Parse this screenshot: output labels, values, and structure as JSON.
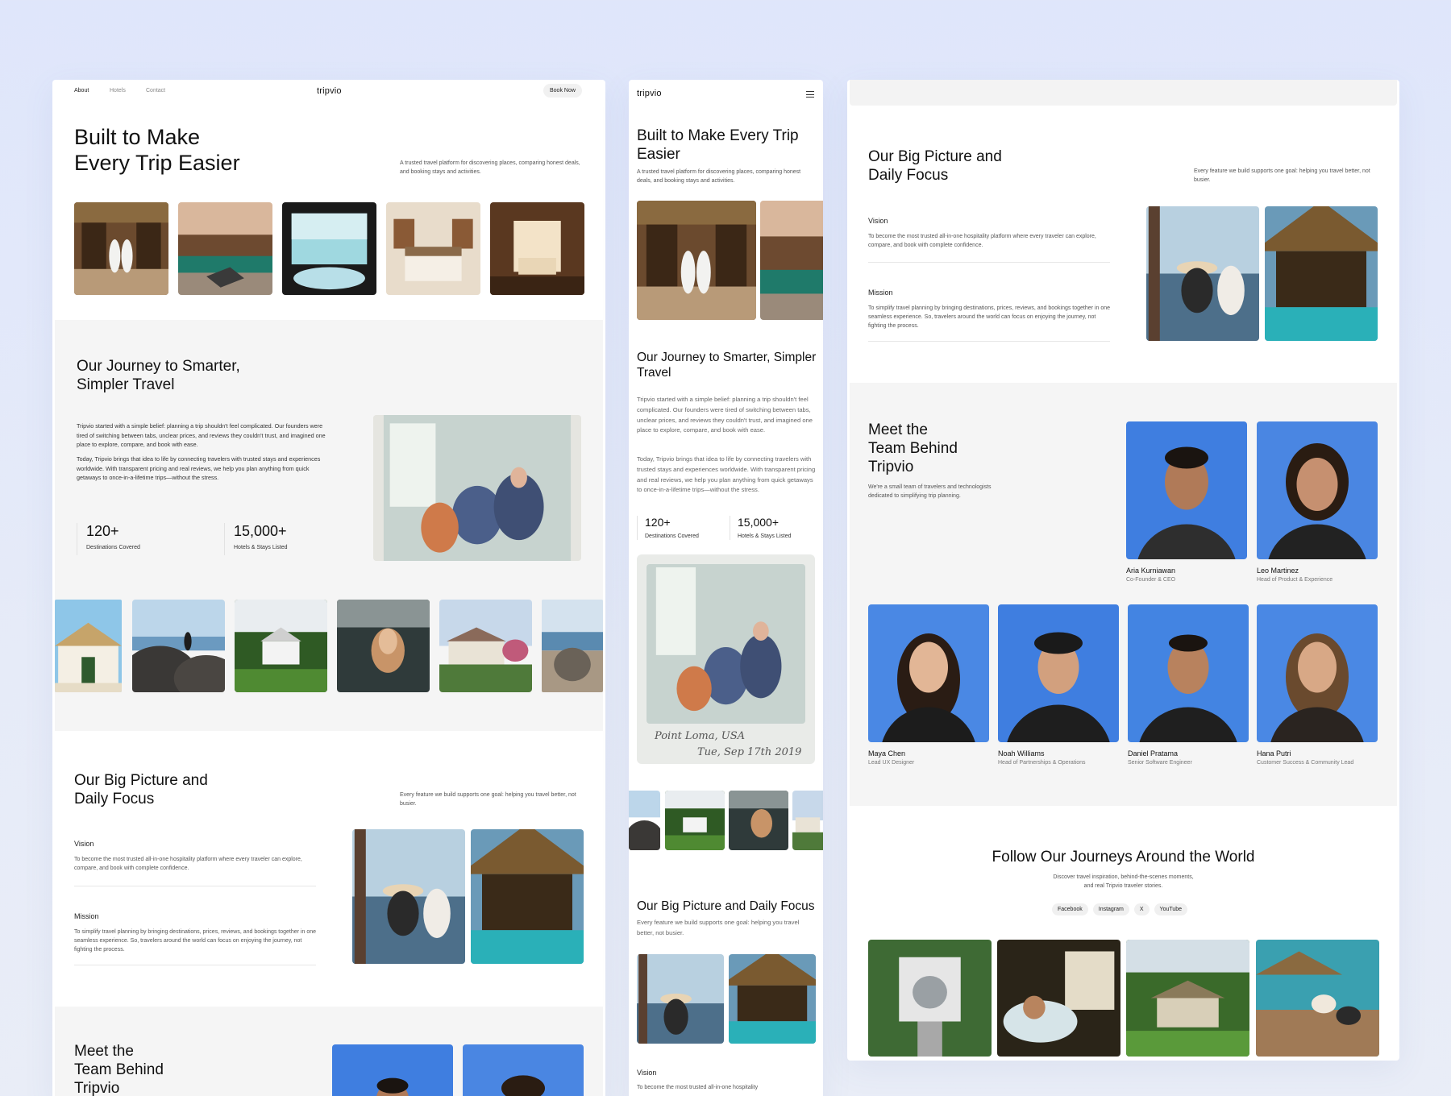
{
  "brand": {
    "logo": "tripvio"
  },
  "nav": {
    "links": [
      "About",
      "Hotels",
      "Contact"
    ],
    "cta": "Book Now"
  },
  "hero": {
    "title_line1": "Built to Make",
    "title_line2": "Every Trip Easier",
    "title_mobile_line1": "Built to Make Every Trip",
    "title_mobile_line2": "Easier",
    "subtitle": "A trusted travel platform for discovering places, comparing honest deals, and booking stays and activities."
  },
  "journey": {
    "title_line1": "Our Journey to Smarter,",
    "title_line2": "Simpler Travel",
    "title_mobile_line1": "Our Journey to Smarter, Simpler",
    "title_mobile_line2": "Travel",
    "para1": "Tripvio started with a simple belief: planning a trip shouldn't feel complicated. Our founders were tired of switching between tabs, unclear prices, and reviews they couldn't trust, and imagined one place to explore, compare, and book with ease.",
    "para2": "Today, Tripvio brings that idea to life by connecting travelers with trusted stays and experiences worldwide. With transparent pricing and real reviews, we help you plan anything from quick getaways to once-in-a-lifetime trips—without the stress.",
    "stats": [
      {
        "value": "120+",
        "label": "Destinations Covered"
      },
      {
        "value": "15,000+",
        "label": "Hotels & Stays Listed"
      }
    ],
    "polaroid_caption_line1": "Point Loma, USA",
    "polaroid_caption_line2": "Tue, Sep 17th 2019"
  },
  "focus": {
    "title_line1": "Our Big Picture and",
    "title_line2": "Daily Focus",
    "title_mobile": "Our Big Picture and Daily Focus",
    "subtitle": "Every feature we build supports one goal: helping you travel better, not busier.",
    "vision_label": "Vision",
    "vision_text": "To become the most trusted all-in-one hospitality platform where every traveler can explore, compare, and book with complete confidence.",
    "vision_text_mobile": "To become the most trusted all-in-one hospitality",
    "mission_label": "Mission",
    "mission_text": "To simplify travel planning by bringing destinations, prices, reviews, and bookings together in one seamless experience. So, travelers around the world can focus on enjoying the journey, not fighting the process."
  },
  "team": {
    "title_line1": "Meet the",
    "title_line2": "Team Behind",
    "title_line3": "Tripvio",
    "subtitle": "We're a small team of travelers and technologists dedicated to simplifying trip planning.",
    "members": [
      {
        "name": "Aria Kurniawan",
        "role": "Co-Founder & CEO"
      },
      {
        "name": "Leo Martinez",
        "role": "Head of Product & Experience"
      },
      {
        "name": "Maya Chen",
        "role": "Lead UX Designer"
      },
      {
        "name": "Noah Williams",
        "role": "Head of Partnerships & Operations"
      },
      {
        "name": "Daniel Pratama",
        "role": "Senior Software Engineer"
      },
      {
        "name": "Hana Putri",
        "role": "Customer Success & Community Lead"
      }
    ]
  },
  "follow": {
    "title": "Follow Our Journeys Around the World",
    "subtitle_line1": "Discover travel inspiration, behind-the-scenes moments,",
    "subtitle_line2": "and real Tripvio traveler stories.",
    "socials": [
      "Facebook",
      "Instagram",
      "X",
      "YouTube"
    ]
  },
  "colors": {
    "background": "#dfe6fb",
    "surface": "#ffffff",
    "section_gray": "#f5f5f5",
    "text": "#151515",
    "muted": "#666666",
    "portrait_sky": "#3f7ee0"
  }
}
